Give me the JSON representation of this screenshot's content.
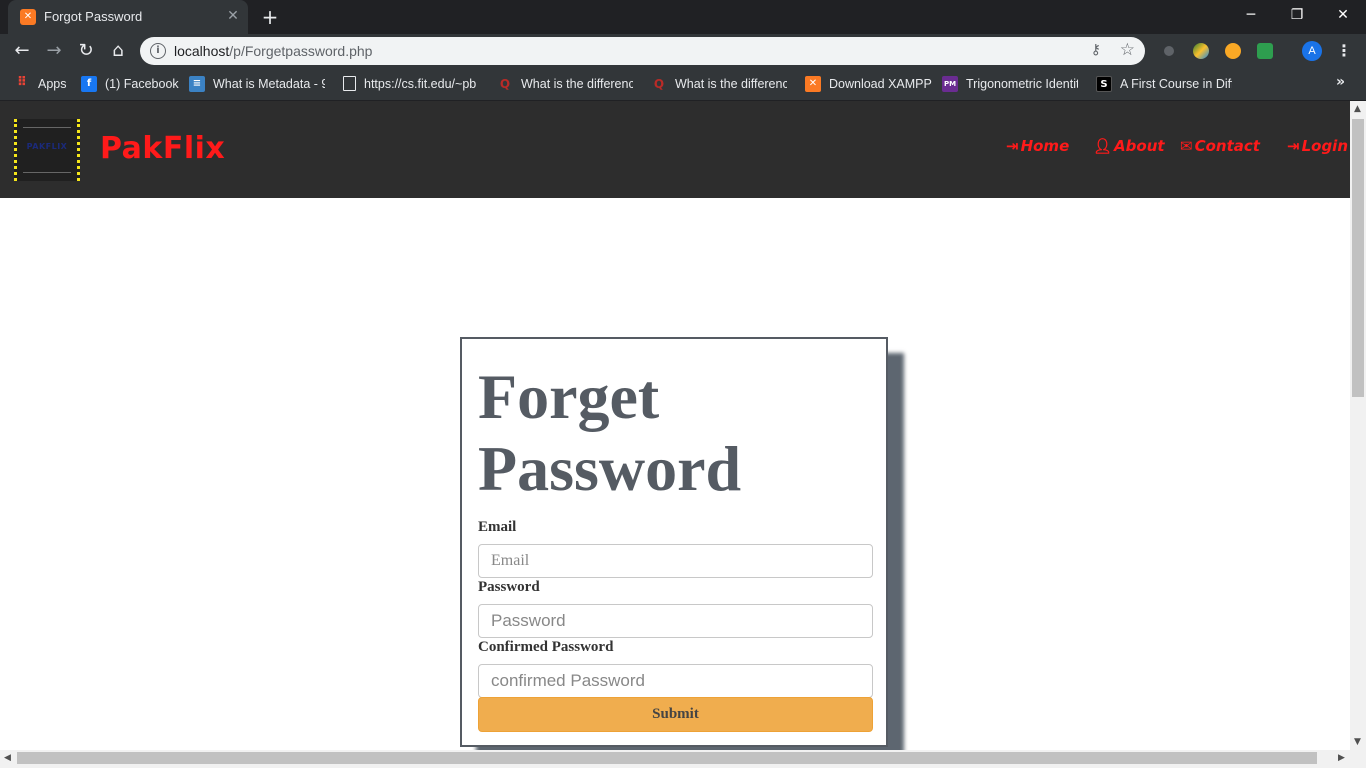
{
  "browser": {
    "tab_title": "Forgot Password",
    "tab_favicon": "xampp-icon",
    "url_host": "localhost",
    "url_path": "/p/Forgetpassword.php",
    "profile_initial": "A",
    "bookmarks": [
      {
        "label": "Apps",
        "icon": "apps-grid-icon",
        "color": "#ea4335"
      },
      {
        "label": "(1) Facebook",
        "icon": "facebook-icon",
        "color": "#1877f2"
      },
      {
        "label": "What is Metadata - 9",
        "icon": "doc-icon",
        "color": "#3b82c4"
      },
      {
        "label": "https://cs.fit.edu/~pb",
        "icon": "page-icon",
        "color": "#e8eaed"
      },
      {
        "label": "What is the difference",
        "icon": "quora-icon",
        "color": "#b92b27"
      },
      {
        "label": "What is the difference",
        "icon": "quora-icon",
        "color": "#b92b27"
      },
      {
        "label": "Download XAMPP",
        "icon": "xampp-icon",
        "color": "#fb7a24"
      },
      {
        "label": "Trigonometric Identiti",
        "icon": "pm-icon",
        "color": "#6a2c91"
      },
      {
        "label": "A First Course in Diffe",
        "icon": "scribd-icon",
        "color": "#000000"
      }
    ]
  },
  "site": {
    "brand": "PakFlix",
    "logo_text": "PAKFLIX",
    "nav": [
      {
        "label": "Home",
        "icon": "sign-in-icon"
      },
      {
        "label": "About",
        "icon": "user-icon"
      },
      {
        "label": "Contact",
        "icon": "envelope-icon"
      },
      {
        "label": "Login",
        "icon": "sign-in-icon"
      }
    ]
  },
  "form": {
    "title": "Forget Password",
    "email_label": "Email",
    "email_placeholder": "Email",
    "password_label": "Password",
    "password_placeholder": "Password",
    "confirm_label": "Confirmed Password",
    "confirm_placeholder": "confirmed Password",
    "submit_label": "Submit"
  },
  "colors": {
    "accent_red": "#ff1a1a",
    "submit_orange": "#f0ad4e",
    "header_dark": "#2d2d2d"
  }
}
